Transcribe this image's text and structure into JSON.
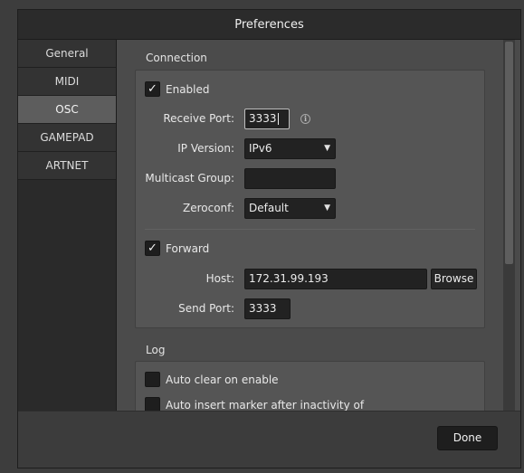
{
  "window": {
    "title": "Preferences"
  },
  "sidebar": {
    "items": [
      {
        "label": "General",
        "active": false
      },
      {
        "label": "MIDI",
        "active": false
      },
      {
        "label": "OSC",
        "active": true
      },
      {
        "label": "GAMEPAD",
        "active": false
      },
      {
        "label": "ARTNET",
        "active": false
      }
    ]
  },
  "connection": {
    "title": "Connection",
    "enabled": {
      "label": "Enabled",
      "checked": true,
      "mark": "✓"
    },
    "receive_port": {
      "label": "Receive Port:",
      "value": "3333",
      "info_icon": "i"
    },
    "ip_version": {
      "label": "IP Version:",
      "value": "IPv6"
    },
    "multicast_group": {
      "label": "Multicast Group:",
      "value": ""
    },
    "zeroconf": {
      "label": "Zeroconf:",
      "value": "Default"
    },
    "forward": {
      "label": "Forward",
      "checked": true,
      "mark": "✓"
    },
    "host": {
      "label": "Host:",
      "value": "172.31.99.193"
    },
    "browse_label": "Browse",
    "send_port": {
      "label": "Send Port:",
      "value": "3333"
    }
  },
  "log": {
    "title": "Log",
    "auto_clear": {
      "label": "Auto clear on enable",
      "checked": false
    },
    "auto_insert": {
      "label": "Auto insert marker after inactivity of",
      "checked": false
    }
  },
  "footer": {
    "done_label": "Done"
  },
  "icons": {
    "dropdown": "chevron-down-icon",
    "info": "info-icon",
    "check": "checkmark-icon"
  },
  "colors": {
    "background": "#4a4a4a",
    "sidebar": "#2a2a2a",
    "active_tab": "#5d5d5d",
    "field": "#222222"
  }
}
